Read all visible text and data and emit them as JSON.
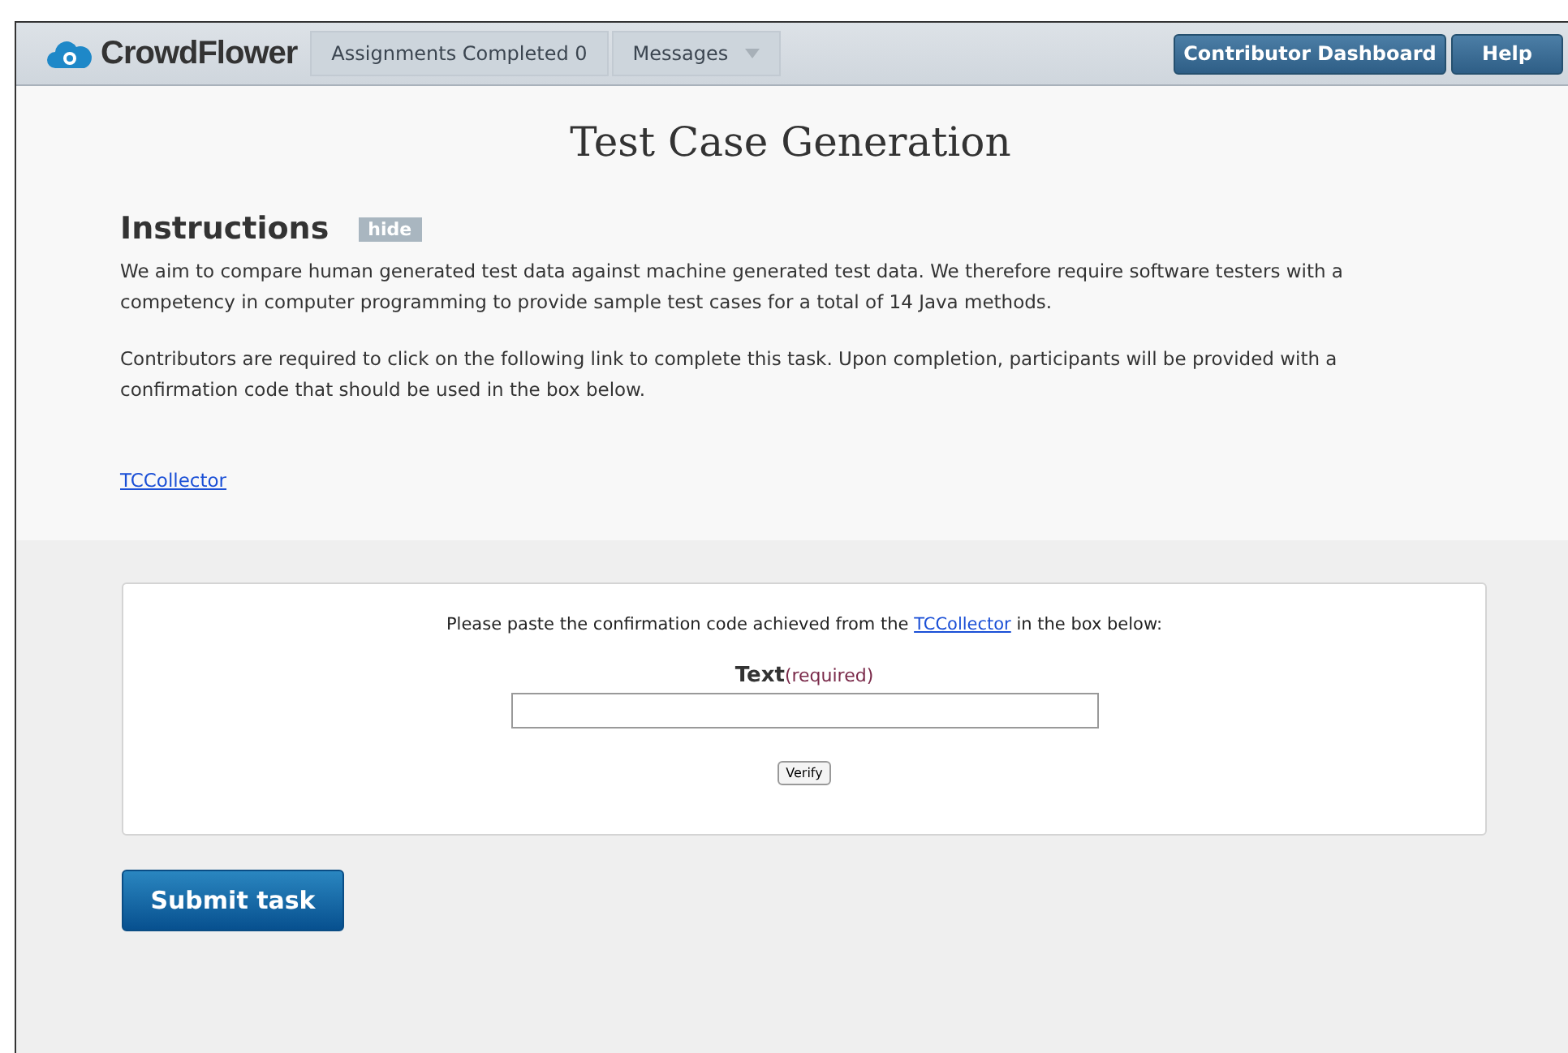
{
  "navbar": {
    "brand": "CrowdFlower",
    "items": [
      {
        "label": "Assignments Completed 0",
        "has_dropdown": false
      },
      {
        "label": "Messages",
        "has_dropdown": true
      }
    ],
    "buttons": [
      "Contributor Dashboard",
      "Help"
    ]
  },
  "title": "Test Case Generation",
  "instructions": {
    "heading": "Instructions",
    "toggle": "hide",
    "paragraphs": [
      "We aim to compare human generated test data against machine generated test data. We therefore require software testers with a competency in computer programming to provide sample test cases for a total of 14 Java methods.",
      "Contributors are required to click on the following link to complete this task. Upon completion, participants will be provided with a confirmation code that should be used in the box below."
    ],
    "link": "TCCollector"
  },
  "form": {
    "prompt_before": "Please paste the confirmation code achieved from the",
    "prompt_link": "TCCollector",
    "prompt_after": "in the box below:",
    "field_label": "Text",
    "field_note": "(required)",
    "verify": "Verify"
  },
  "submit": "Submit task"
}
